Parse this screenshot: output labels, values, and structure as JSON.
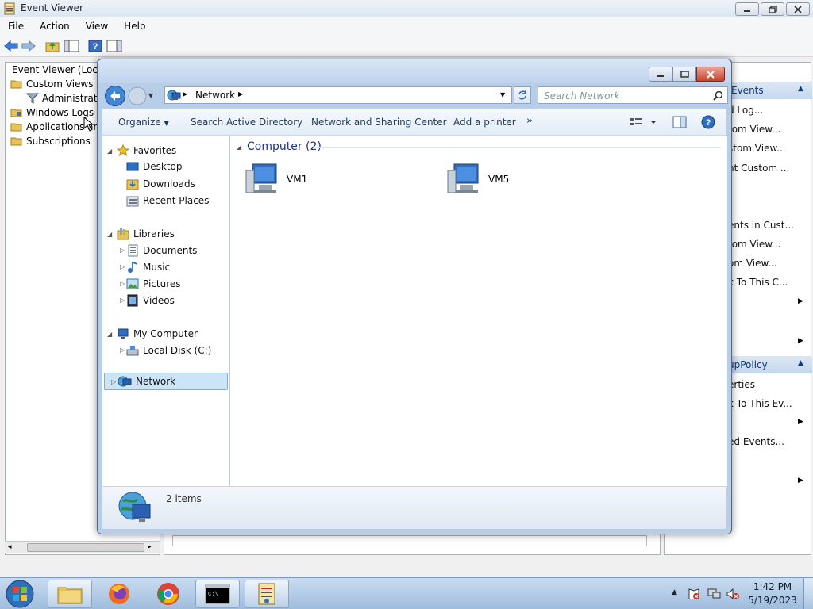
{
  "event_viewer": {
    "title": "Event Viewer",
    "menu": [
      "File",
      "Action",
      "View",
      "Help"
    ],
    "tree": {
      "root": "Event Viewer (Local)",
      "custom_views": "Custom Views",
      "administrative": "Administrativ",
      "windows_logs": "Windows Logs",
      "applications": "Applications and",
      "subscriptions": "Subscriptions"
    },
    "actions": {
      "header1": "Events",
      "items1": [
        "d Log...",
        "tom View...",
        "stom View...",
        "nt Custom ...",
        "ents in Cust...",
        "tom View...",
        "om View...",
        "k To This C..."
      ],
      "header2": "upPolicy",
      "items2": [
        "erties",
        "k To This Ev...",
        "ed Events..."
      ]
    }
  },
  "explorer": {
    "breadcrumb": "Network",
    "search_placeholder": "Search Network",
    "commands": {
      "organize": "Organize",
      "search_ad": "Search Active Directory",
      "network_sharing": "Network and Sharing Center",
      "add_printer": "Add a printer",
      "more": "»"
    },
    "nav": {
      "favorites": "Favorites",
      "desktop": "Desktop",
      "downloads": "Downloads",
      "recent": "Recent Places",
      "libraries": "Libraries",
      "documents": "Documents",
      "music": "Music",
      "pictures": "Pictures",
      "videos": "Videos",
      "my_computer": "My Computer",
      "local_disk": "Local Disk (C:)",
      "network": "Network"
    },
    "group_header": "Computer (2)",
    "items": [
      "VM1",
      "VM5"
    ],
    "details_text": "2 items"
  },
  "taskbar": {
    "time": "1:42 PM",
    "date": "5/19/2023"
  },
  "colors": {
    "selection": "#cce4f7",
    "group_header": "#1e3287",
    "link": "#1e395b"
  }
}
